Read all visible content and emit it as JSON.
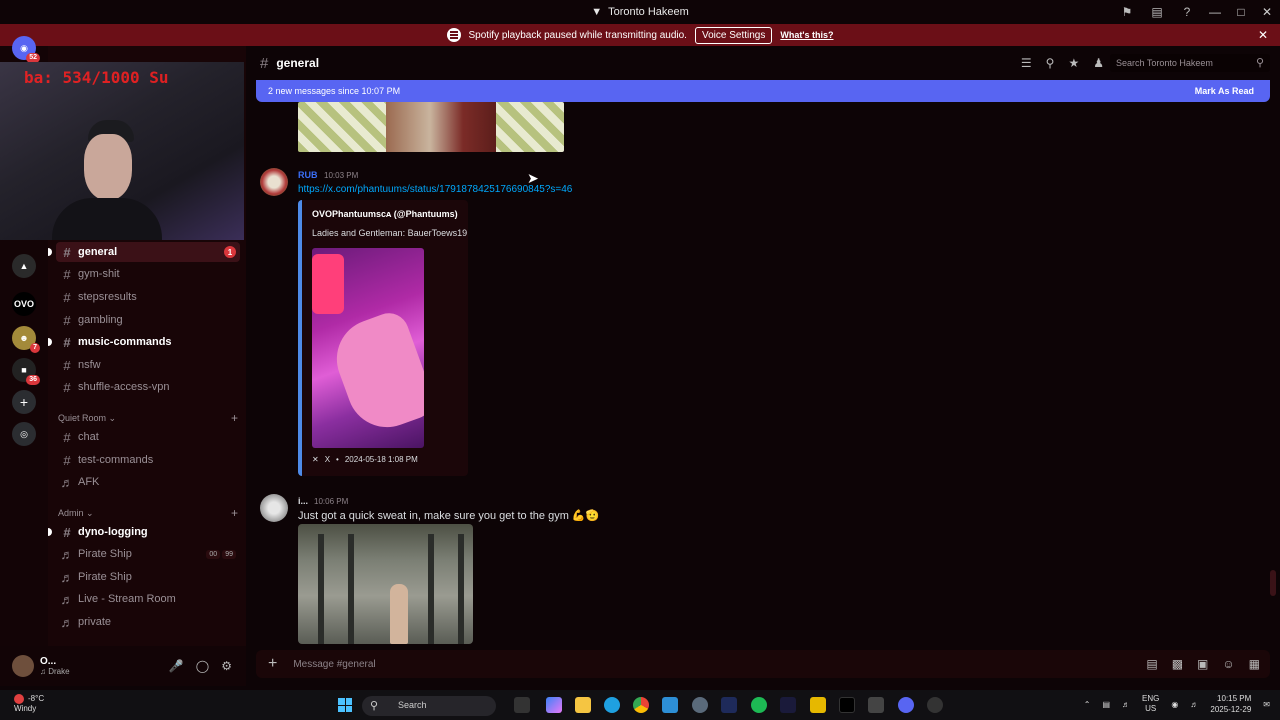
{
  "window": {
    "title": "Toronto Hakeem"
  },
  "notice": {
    "text": "Spotify playback paused while transmitting audio.",
    "voice_settings": "Voice Settings",
    "whats_this": "What's this?"
  },
  "rail": {
    "badges": [
      "52",
      "7",
      "36"
    ]
  },
  "webcam": {
    "overlay_text": "ba: 534/1000 Su"
  },
  "channels": {
    "text": [
      "general",
      "gym-shit",
      "stepsresults",
      "gambling",
      "music-commands",
      "nsfw",
      "shuffle-access-vpn"
    ],
    "general_mentions": "1",
    "quiet_room": {
      "label": "Quiet Room",
      "items": [
        "chat",
        "test-commands",
        "AFK"
      ]
    },
    "admin": {
      "label": "Admin",
      "items": [
        "dyno-logging",
        "Pirate Ship",
        "Pirate Ship",
        "Live - Stream Room",
        "private"
      ]
    },
    "pirate_counters": [
      "00",
      "99"
    ]
  },
  "user": {
    "name": "O...",
    "status": "♫ Drake"
  },
  "header": {
    "channel": "general",
    "search_placeholder": "Search Toronto Hakeem"
  },
  "new_messages": {
    "text": "2 new messages since 10:07 PM",
    "mark": "Mark As Read"
  },
  "messages": [
    {
      "author": "RUB",
      "author_color": "#3b6ef5",
      "time": "10:03 PM",
      "link": "https://x.com/phantuums/status/1791878425176690845?s=46",
      "embed": {
        "author": "OVOPhantuumsᴄᴀ (@Phantuums)",
        "description": "Ladies and Gentleman: BauerToews19",
        "footer_source": "X",
        "footer_date": "2024-05-18 1:08 PM"
      }
    },
    {
      "author": "i...",
      "time": "10:06 PM",
      "text": "Just got a quick sweat in, make sure you get to the gym 💪🫡"
    }
  ],
  "composer": {
    "placeholder": "Message #general"
  },
  "taskbar": {
    "weather_temp": "-8°C",
    "weather_desc": "Windy",
    "search": "Search",
    "lang_top": "ENG",
    "lang_bottom": "US",
    "time": "10:15 PM",
    "date": "2025-12-29"
  }
}
